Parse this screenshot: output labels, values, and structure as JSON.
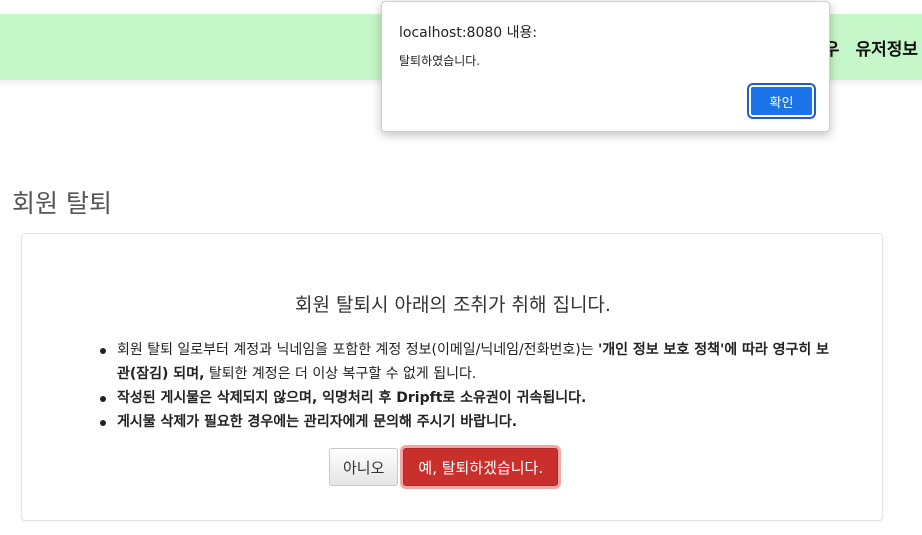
{
  "navbar": {
    "items": [
      "우",
      "유저정보"
    ]
  },
  "page": {
    "title": "회원 탈퇴"
  },
  "card": {
    "heading": "회원 탈퇴시 아래의 조취가 취해 집니다.",
    "notice1_part1": "회원 탈퇴 일로부터 계정과 닉네임을 포함한 계정 정보(이메일/닉네임/전화번호)는 ",
    "notice1_bold": "'개인 정보 보호 정책'에 따라 영구히 보관(잠김) 되며,",
    "notice1_part2": " 탈퇴한 계정은 더 이상 복구할 수 없게 됩니다.",
    "notice2": "작성된 게시물은 삭제되지 않으며, 익명처리 후 Dripft로 소유권이 귀속됩니다.",
    "notice3": "게시물 삭제가 필요한 경우에는 관리자에게 문의해 주시기 바랍니다.",
    "no_label": "아니오",
    "yes_label": "예, 탈퇴하겠습니다."
  },
  "alert": {
    "origin": "localhost:8080 내용:",
    "message": "탈퇴하였습니다.",
    "ok_label": "확인"
  },
  "colors": {
    "navbar_bg": "#c6f7c9",
    "danger": "#c9302c",
    "alert_button": "#1a73e8"
  }
}
